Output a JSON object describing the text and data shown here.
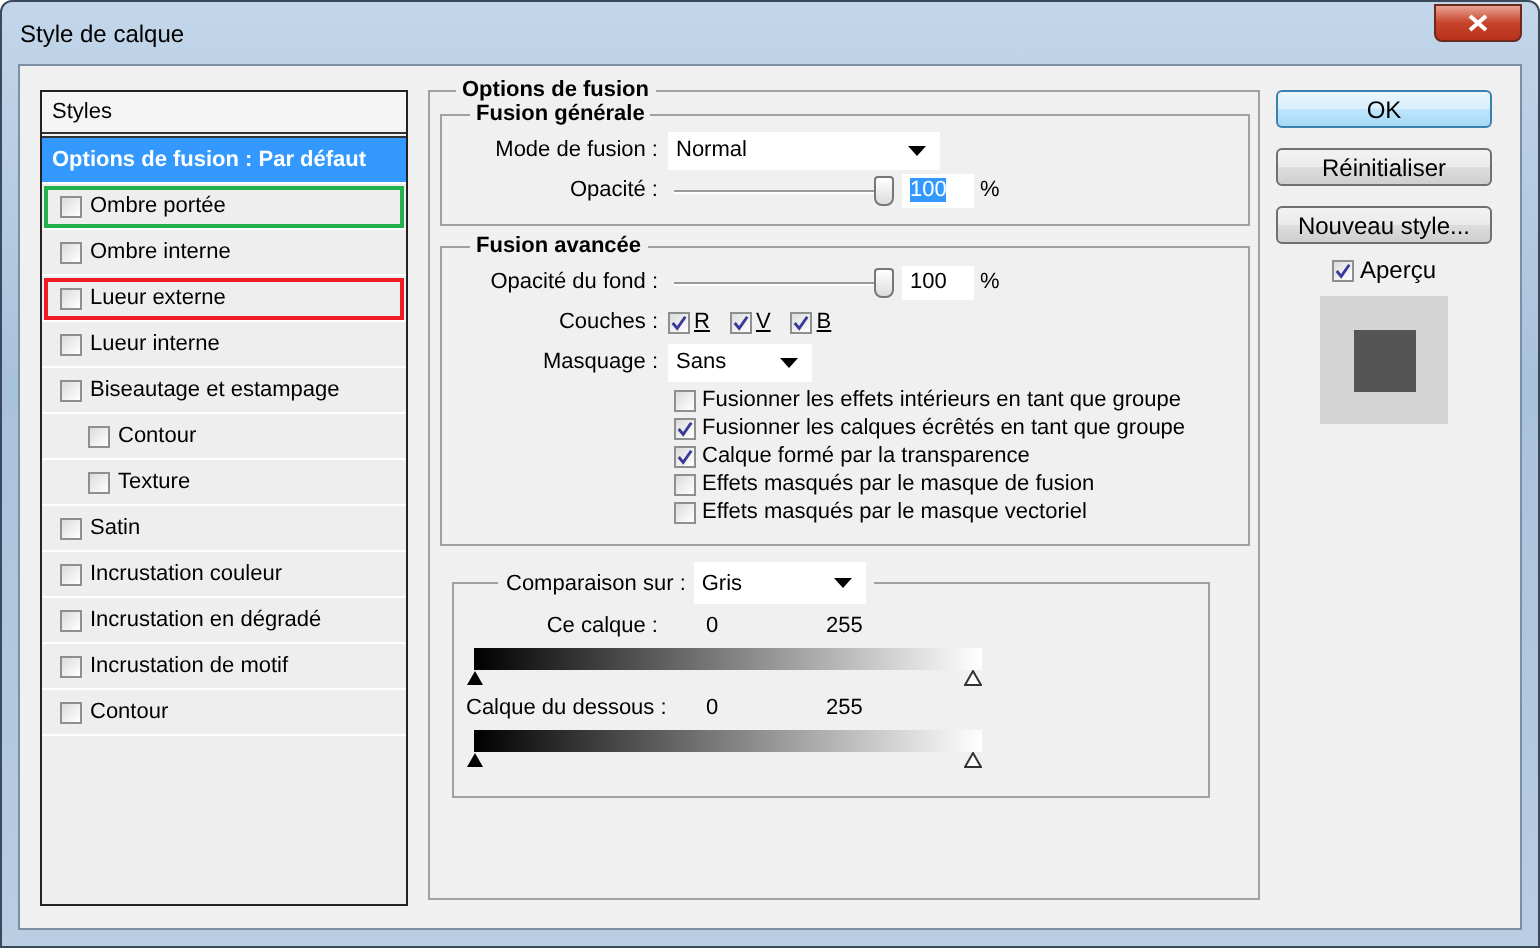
{
  "window": {
    "title": "Style de calque"
  },
  "sidebar": {
    "header": "Styles",
    "items": [
      {
        "kind": "header",
        "label": "Options de fusion : Par défaut",
        "selected": true
      },
      {
        "kind": "effect",
        "label": "Ombre portée",
        "checked": false,
        "selected": false,
        "color": "#22b14c"
      },
      {
        "kind": "effect",
        "label": "Ombre interne",
        "checked": false,
        "selected": false
      },
      {
        "kind": "effect",
        "label": "Lueur externe",
        "checked": false,
        "selected": false,
        "color": "#ed1c24"
      },
      {
        "kind": "effect",
        "label": "Lueur interne",
        "checked": false,
        "selected": false
      },
      {
        "kind": "effect",
        "label": "Biseautage et estampage",
        "checked": false,
        "selected": false,
        "children": [
          {
            "kind": "effect",
            "label": "Contour",
            "checked": false,
            "selected": false
          },
          {
            "kind": "effect",
            "label": "Texture",
            "checked": false,
            "selected": false
          }
        ]
      },
      {
        "kind": "effect",
        "label": "Satin",
        "checked": false,
        "selected": false
      },
      {
        "kind": "effect",
        "label": "Incrustation couleur",
        "checked": false,
        "selected": false
      },
      {
        "kind": "effect",
        "label": "Incrustation en dégradé",
        "checked": false,
        "selected": false
      },
      {
        "kind": "effect",
        "label": "Incrustation de motif",
        "checked": false,
        "selected": false
      },
      {
        "kind": "effect",
        "label": "Contour",
        "checked": false,
        "selected": false
      }
    ]
  },
  "options": {
    "title": "Options de fusion",
    "general": {
      "title": "Fusion générale",
      "mode_label": "Mode de fusion :",
      "mode_value": "Normal",
      "opacity_label": "Opacité :",
      "opacity": {
        "level": 1,
        "value": "100",
        "unit": "%",
        "highlighted": true
      }
    },
    "advanced": {
      "title": "Fusion avancée",
      "fill_label": "Opacité du fond :",
      "fill": {
        "level": 1,
        "value": "100",
        "unit": "%",
        "highlighted": false
      },
      "channels_label": "Couches :",
      "channels": [
        {
          "label": "R",
          "checked": true
        },
        {
          "label": "V",
          "checked": true
        },
        {
          "label": "B",
          "checked": true
        }
      ],
      "knockout_label": "Masquage :",
      "knockout_value": "Sans",
      "checkboxes": [
        {
          "label": "Fusionner les effets intérieurs en tant que groupe",
          "checked": false
        },
        {
          "label": "Fusionner les calques écrêtés en tant que groupe",
          "checked": true
        },
        {
          "label": "Calque formé par la transparence",
          "checked": true
        },
        {
          "label": "Effets masqués par le masque de fusion",
          "checked": false
        },
        {
          "label": "Effets masqués par le masque vectoriel",
          "checked": false
        }
      ]
    },
    "blend_if": {
      "label": "Comparaison sur :",
      "value": "Gris",
      "bars": [
        {
          "label": "Ce calque :",
          "low": "0",
          "high": "255"
        },
        {
          "label": "Calque du dessous :",
          "low": "0",
          "high": "255"
        }
      ]
    }
  },
  "buttons": [
    {
      "label": "OK",
      "default": true
    },
    {
      "label": "Réinitialiser",
      "default": false
    },
    {
      "label": "Nouveau style...",
      "default": false
    }
  ],
  "preview": {
    "label": "Aperçu",
    "checked": true
  }
}
